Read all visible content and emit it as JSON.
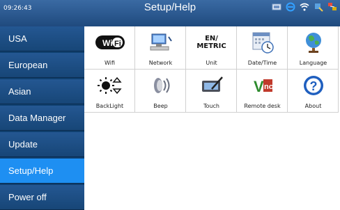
{
  "status": {
    "time": "09:26:43",
    "title": "Setup/Help",
    "icons": [
      "screen-icon",
      "browser-icon",
      "wifi-icon",
      "usb-icon",
      "network-icon"
    ]
  },
  "sidebar": {
    "items": [
      {
        "label": "USA"
      },
      {
        "label": "European"
      },
      {
        "label": "Asian"
      },
      {
        "label": "Data Manager"
      },
      {
        "label": "Update"
      },
      {
        "label": "Setup/Help",
        "active": true
      },
      {
        "label": "Power off"
      }
    ]
  },
  "tiles": [
    {
      "label": "Wifi",
      "icon": "wifi-logo-icon"
    },
    {
      "label": "Network",
      "icon": "network-computer-icon"
    },
    {
      "label": "Unit",
      "icon": "unit-icon",
      "icon_text": "EN/\nMETRIC"
    },
    {
      "label": "Date/Time",
      "icon": "calendar-clock-icon"
    },
    {
      "label": "Language",
      "icon": "globe-icon"
    },
    {
      "label": "BackLight",
      "icon": "brightness-icon"
    },
    {
      "label": "Beep",
      "icon": "speaker-icon"
    },
    {
      "label": "Touch",
      "icon": "touch-pen-icon"
    },
    {
      "label": "Remote desk",
      "icon": "vnc-icon",
      "icon_text": "Vnc"
    },
    {
      "label": "About",
      "icon": "help-icon",
      "icon_text": "?"
    }
  ],
  "colors": {
    "topbar": "#2d5c94",
    "sidebar": "#174677",
    "active": "#1e8ff2"
  }
}
